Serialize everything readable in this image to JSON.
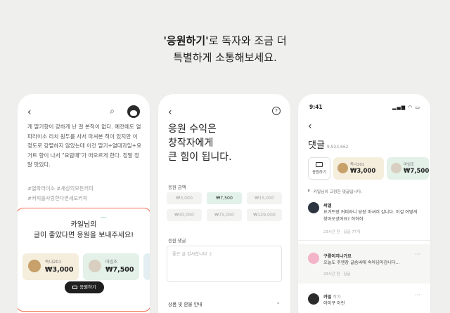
{
  "headline": {
    "strong": "'응원하기'",
    "line1_rest": "로 독자와 조금 더",
    "line2": "특별하게 소통해보세요."
  },
  "phone1": {
    "back_icon": "chevron-left-icon",
    "body": "게 딸기향이 강하게 난 걸 본적이 없다. 예전에도 열파라이소 리치 원두를 사서 마셔본 적이 있지만 이 정도로 강렬하지 않았는데 이건 딸기+열대과일+요거트 향이 나서 \"요맘때\"가 떠오르게 한다. 정말 정말 맛있다.",
    "tags": [
      "#열파라이소  #새상의모든커피",
      "#커피를사랑한다면세모커피"
    ],
    "support_line1": "카일님의",
    "support_line2_pre": "글이 좋았다면 ",
    "support_line2_hl": "응원",
    "support_line2_post": "을 보내주세요!",
    "chips": [
      {
        "name": "독나201",
        "amount": "₩3,000",
        "bg": "#f5eedd",
        "icon": "#c7a06a"
      },
      {
        "name": "마임조",
        "amount": "₩7,500",
        "bg": "#e3f1e9",
        "icon": "#d9cfc0"
      }
    ],
    "button_label": "응원하기"
  },
  "phone2": {
    "help_icon": "?",
    "title_lines": [
      "응원 수익은",
      "창작자에게",
      "큰 힘이 됩니다."
    ],
    "amount_label": "응원 금액",
    "amounts": [
      "₩3,000",
      "₩7,500",
      "₩15,000",
      "₩30,000",
      "₩75,000",
      "₩129,000"
    ],
    "selected_amount": "₩7,500",
    "comment_label": "응원 댓글",
    "comment_placeholder": "좋은 글 감사합니다 :)",
    "refund_label": "상품 및 환불 안내"
  },
  "phone3": {
    "time": "9:41",
    "status_icons": "▂▄▆ ◠ ▭",
    "title": "댓글",
    "count": "9,923,662",
    "support_label": "응원하기",
    "chips": [
      {
        "name": "독나201",
        "amount": "₩3,000",
        "bg": "#f5eedd",
        "icon": "#c7a06a"
      },
      {
        "name": "마임조",
        "amount": "₩7,500",
        "bg": "#e3f1e9",
        "icon": "#d9cfc0"
      }
    ],
    "notice": "카일님이 고정한 댓글입니다.",
    "comments": [
      {
        "author": "써엘",
        "text": "요거트랑 커피라니 당장 마셔러 갑니다. 이걸 어떻게 찾아오셨어요? 허허허",
        "meta": "23시간 전 · 답글 77개"
      },
      {
        "author": "구름이지나가요",
        "text": "오늘도 주엔장 글솜씨에 속아넘어갑니다...",
        "meta": "23시간 전 · 답글"
      },
      {
        "author": "카일",
        "sub": "작가",
        "text": "아이쿠 이런",
        "meta": ""
      }
    ]
  }
}
